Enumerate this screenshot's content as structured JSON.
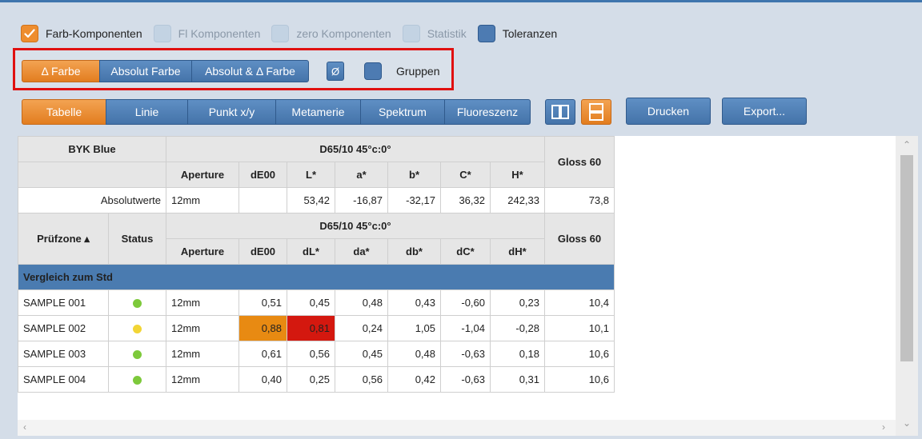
{
  "checkboxes": [
    {
      "label": "Farb-Komponenten",
      "state": "checked"
    },
    {
      "label": "Fl Komponenten",
      "state": "disabled"
    },
    {
      "label": "zero Komponenten",
      "state": "disabled"
    },
    {
      "label": "Statistik",
      "state": "disabled"
    },
    {
      "label": "Toleranzen",
      "state": "enabled"
    }
  ],
  "mode_segments": {
    "delta_farbe": "Δ Farbe",
    "absolut_farbe": "Absolut Farbe",
    "absolut_delta": "Absolut & Δ Farbe",
    "average": "Ø",
    "gruppen": "Gruppen"
  },
  "tabs": {
    "tabelle": "Tabelle",
    "linie": "Linie",
    "punkt": "Punkt x/y",
    "metamerie": "Metamerie",
    "spektrum": "Spektrum",
    "fluoreszenz": "Fluoreszenz"
  },
  "actions": {
    "drucken": "Drucken",
    "export": "Export..."
  },
  "colors": {
    "accent_orange": "#ee8d2e",
    "accent_blue": "#4a7bb0",
    "status_green": "#7dc93b",
    "status_yellow": "#f2d535"
  },
  "table": {
    "standard_name": "BYK Blue",
    "condition": "D65/10 45°c:0°",
    "gloss_header": "Gloss 60",
    "abs_headers": {
      "aperture": "Aperture",
      "de": "dE00",
      "l": "L*",
      "a": "a*",
      "b": "b*",
      "c": "C*",
      "h": "H*"
    },
    "absolute_row": {
      "label": "Absolutwerte",
      "aperture": "12mm",
      "de": "",
      "l": "53,42",
      "a": "-16,87",
      "b": "-32,17",
      "c": "36,32",
      "h": "242,33",
      "gloss": "73,8"
    },
    "sample_headers": {
      "zone": "Prüfzone ▴",
      "status": "Status",
      "aperture": "Aperture",
      "de": "dE00",
      "dl": "dL*",
      "da": "da*",
      "db": "db*",
      "dc": "dC*",
      "dh": "dH*"
    },
    "group_label": "Vergleich zum Std",
    "rows": [
      {
        "name": "SAMPLE 001",
        "status": "green",
        "aperture": "12mm",
        "de": "0,51",
        "dl": "0,45",
        "da": "0,48",
        "db": "0,43",
        "dc": "-0,60",
        "dh": "0,23",
        "gloss": "10,4"
      },
      {
        "name": "SAMPLE 002",
        "status": "yellow",
        "aperture": "12mm",
        "de": "0,88",
        "dl": "0,81",
        "da": "0,24",
        "db": "1,05",
        "dc": "-1,04",
        "dh": "-0,28",
        "gloss": "10,1"
      },
      {
        "name": "SAMPLE 003",
        "status": "green",
        "aperture": "12mm",
        "de": "0,61",
        "dl": "0,56",
        "da": "0,45",
        "db": "0,48",
        "dc": "-0,63",
        "dh": "0,18",
        "gloss": "10,6"
      },
      {
        "name": "SAMPLE 004",
        "status": "green",
        "aperture": "12mm",
        "de": "0,40",
        "dl": "0,25",
        "da": "0,56",
        "db": "0,42",
        "dc": "-0,63",
        "dh": "0,31",
        "gloss": "10,6"
      }
    ]
  }
}
